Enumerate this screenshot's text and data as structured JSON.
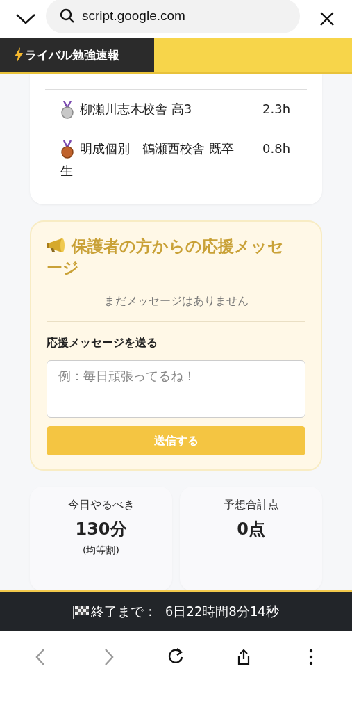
{
  "browser_bar": {
    "address": "script.google.com"
  },
  "banner": {
    "title": "ライバル勉強速報"
  },
  "ranking": {
    "rows": [
      {
        "kind": "silver",
        "name": "柳瀬川志木校舎 高3",
        "hours": "2.3h"
      },
      {
        "kind": "bronze",
        "name": "明成個別　鶴瀬西校舎 既卒生",
        "hours": "0.8h"
      }
    ]
  },
  "messages": {
    "title": "保護者の方からの応援メッセージ",
    "empty": "まだメッセージはありません",
    "form_label": "応援メッセージを送る",
    "placeholder": "例：毎日頑張ってるね！",
    "button": "送信する"
  },
  "stats": [
    {
      "label": "今日やるべき",
      "value": "130分",
      "note": "(均等割)"
    },
    {
      "label": "予想合計点",
      "value": "0点"
    }
  ],
  "countdown": {
    "text": "終了まで： 6日22時間8分14秒"
  },
  "toolbar": [
    {
      "kind": "back",
      "disabled": true
    },
    {
      "kind": "forward",
      "disabled": true
    },
    {
      "kind": "reload",
      "disabled": false
    },
    {
      "kind": "share",
      "disabled": false
    },
    {
      "kind": "more",
      "disabled": false
    }
  ]
}
